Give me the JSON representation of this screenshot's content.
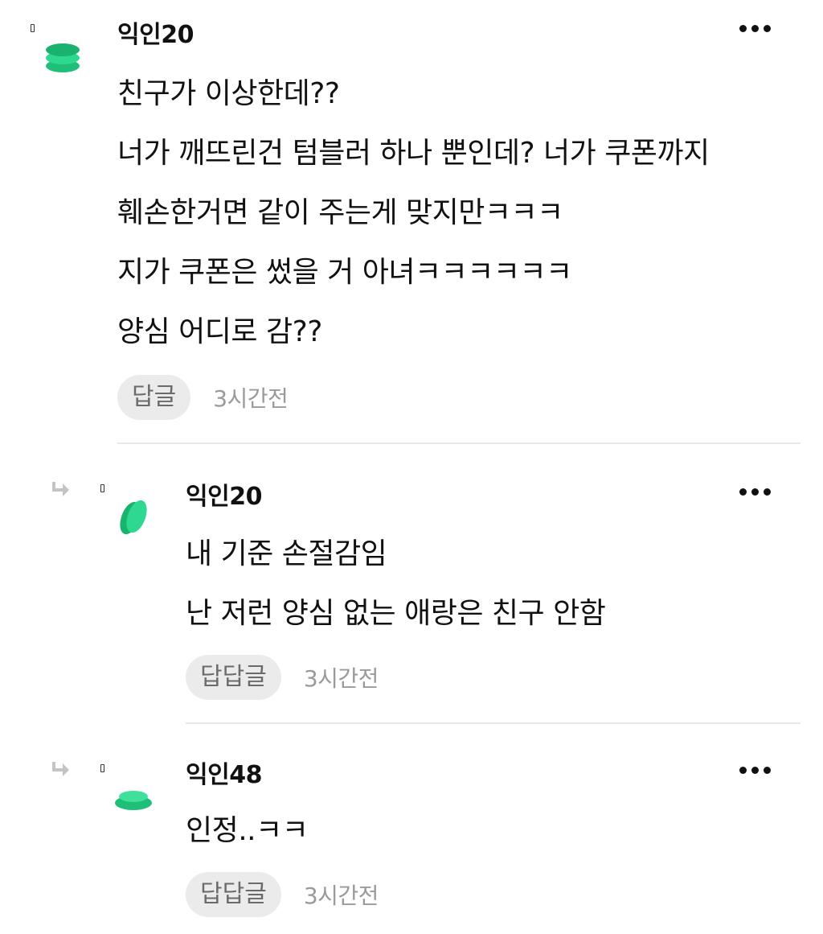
{
  "comments": [
    {
      "author": "익인20",
      "lines": [
        "친구가 이상한데??",
        "너가 깨뜨린건 텀블러 하나 뿐인데? 너가 쿠폰까지",
        "훼손한거면 같이 주는게 맞지만ㅋㅋㅋ",
        "지가 쿠폰은 썼을 거 아녀ㅋㅋㅋㅋㅋㅋ",
        "양심 어디로 감??"
      ],
      "reply_label": "답글",
      "time": "3시간전"
    },
    {
      "author": "익인20",
      "lines": [
        "내 기준 손절감임",
        "난 저런 양심 없는 애랑은 친구 안함"
      ],
      "reply_label": "답답글",
      "time": "3시간전"
    },
    {
      "author": "익인48",
      "lines": [
        "인정..ㅋㅋ"
      ],
      "reply_label": "답답글",
      "time": "3시간전"
    }
  ],
  "icons": {
    "more": "more-dots-icon",
    "reply_arrow": "reply-arrow-icon",
    "avatar": "avatar-icon"
  },
  "colors": {
    "avatar_green": "#2ecf8a",
    "avatar_dark_green": "#18b46e",
    "text": "#111111",
    "meta_gray": "#9a9a9a",
    "button_bg": "#ebebeb",
    "divider": "#e8e8e8"
  }
}
